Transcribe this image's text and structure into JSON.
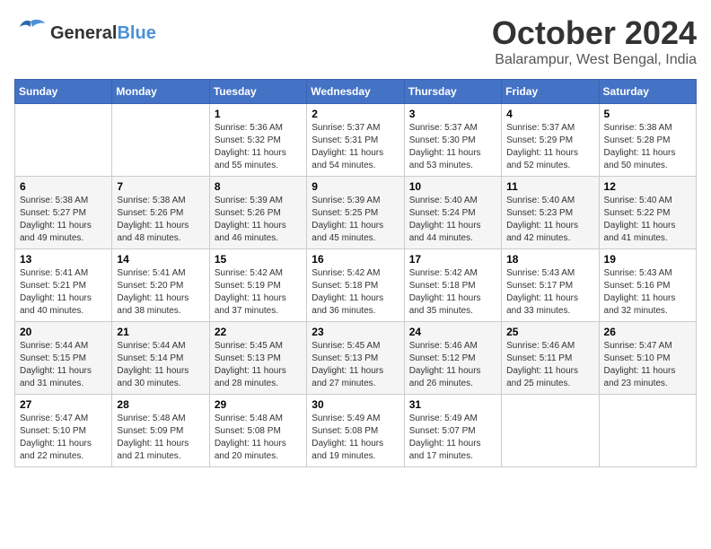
{
  "header": {
    "logo_general": "General",
    "logo_blue": "Blue",
    "month": "October 2024",
    "location": "Balarampur, West Bengal, India"
  },
  "weekdays": [
    "Sunday",
    "Monday",
    "Tuesday",
    "Wednesday",
    "Thursday",
    "Friday",
    "Saturday"
  ],
  "weeks": [
    [
      {
        "day": "",
        "info": ""
      },
      {
        "day": "",
        "info": ""
      },
      {
        "day": "1",
        "sunrise": "Sunrise: 5:36 AM",
        "sunset": "Sunset: 5:32 PM",
        "daylight": "Daylight: 11 hours and 55 minutes."
      },
      {
        "day": "2",
        "sunrise": "Sunrise: 5:37 AM",
        "sunset": "Sunset: 5:31 PM",
        "daylight": "Daylight: 11 hours and 54 minutes."
      },
      {
        "day": "3",
        "sunrise": "Sunrise: 5:37 AM",
        "sunset": "Sunset: 5:30 PM",
        "daylight": "Daylight: 11 hours and 53 minutes."
      },
      {
        "day": "4",
        "sunrise": "Sunrise: 5:37 AM",
        "sunset": "Sunset: 5:29 PM",
        "daylight": "Daylight: 11 hours and 52 minutes."
      },
      {
        "day": "5",
        "sunrise": "Sunrise: 5:38 AM",
        "sunset": "Sunset: 5:28 PM",
        "daylight": "Daylight: 11 hours and 50 minutes."
      }
    ],
    [
      {
        "day": "6",
        "sunrise": "Sunrise: 5:38 AM",
        "sunset": "Sunset: 5:27 PM",
        "daylight": "Daylight: 11 hours and 49 minutes."
      },
      {
        "day": "7",
        "sunrise": "Sunrise: 5:38 AM",
        "sunset": "Sunset: 5:26 PM",
        "daylight": "Daylight: 11 hours and 48 minutes."
      },
      {
        "day": "8",
        "sunrise": "Sunrise: 5:39 AM",
        "sunset": "Sunset: 5:26 PM",
        "daylight": "Daylight: 11 hours and 46 minutes."
      },
      {
        "day": "9",
        "sunrise": "Sunrise: 5:39 AM",
        "sunset": "Sunset: 5:25 PM",
        "daylight": "Daylight: 11 hours and 45 minutes."
      },
      {
        "day": "10",
        "sunrise": "Sunrise: 5:40 AM",
        "sunset": "Sunset: 5:24 PM",
        "daylight": "Daylight: 11 hours and 44 minutes."
      },
      {
        "day": "11",
        "sunrise": "Sunrise: 5:40 AM",
        "sunset": "Sunset: 5:23 PM",
        "daylight": "Daylight: 11 hours and 42 minutes."
      },
      {
        "day": "12",
        "sunrise": "Sunrise: 5:40 AM",
        "sunset": "Sunset: 5:22 PM",
        "daylight": "Daylight: 11 hours and 41 minutes."
      }
    ],
    [
      {
        "day": "13",
        "sunrise": "Sunrise: 5:41 AM",
        "sunset": "Sunset: 5:21 PM",
        "daylight": "Daylight: 11 hours and 40 minutes."
      },
      {
        "day": "14",
        "sunrise": "Sunrise: 5:41 AM",
        "sunset": "Sunset: 5:20 PM",
        "daylight": "Daylight: 11 hours and 38 minutes."
      },
      {
        "day": "15",
        "sunrise": "Sunrise: 5:42 AM",
        "sunset": "Sunset: 5:19 PM",
        "daylight": "Daylight: 11 hours and 37 minutes."
      },
      {
        "day": "16",
        "sunrise": "Sunrise: 5:42 AM",
        "sunset": "Sunset: 5:18 PM",
        "daylight": "Daylight: 11 hours and 36 minutes."
      },
      {
        "day": "17",
        "sunrise": "Sunrise: 5:42 AM",
        "sunset": "Sunset: 5:18 PM",
        "daylight": "Daylight: 11 hours and 35 minutes."
      },
      {
        "day": "18",
        "sunrise": "Sunrise: 5:43 AM",
        "sunset": "Sunset: 5:17 PM",
        "daylight": "Daylight: 11 hours and 33 minutes."
      },
      {
        "day": "19",
        "sunrise": "Sunrise: 5:43 AM",
        "sunset": "Sunset: 5:16 PM",
        "daylight": "Daylight: 11 hours and 32 minutes."
      }
    ],
    [
      {
        "day": "20",
        "sunrise": "Sunrise: 5:44 AM",
        "sunset": "Sunset: 5:15 PM",
        "daylight": "Daylight: 11 hours and 31 minutes."
      },
      {
        "day": "21",
        "sunrise": "Sunrise: 5:44 AM",
        "sunset": "Sunset: 5:14 PM",
        "daylight": "Daylight: 11 hours and 30 minutes."
      },
      {
        "day": "22",
        "sunrise": "Sunrise: 5:45 AM",
        "sunset": "Sunset: 5:13 PM",
        "daylight": "Daylight: 11 hours and 28 minutes."
      },
      {
        "day": "23",
        "sunrise": "Sunrise: 5:45 AM",
        "sunset": "Sunset: 5:13 PM",
        "daylight": "Daylight: 11 hours and 27 minutes."
      },
      {
        "day": "24",
        "sunrise": "Sunrise: 5:46 AM",
        "sunset": "Sunset: 5:12 PM",
        "daylight": "Daylight: 11 hours and 26 minutes."
      },
      {
        "day": "25",
        "sunrise": "Sunrise: 5:46 AM",
        "sunset": "Sunset: 5:11 PM",
        "daylight": "Daylight: 11 hours and 25 minutes."
      },
      {
        "day": "26",
        "sunrise": "Sunrise: 5:47 AM",
        "sunset": "Sunset: 5:10 PM",
        "daylight": "Daylight: 11 hours and 23 minutes."
      }
    ],
    [
      {
        "day": "27",
        "sunrise": "Sunrise: 5:47 AM",
        "sunset": "Sunset: 5:10 PM",
        "daylight": "Daylight: 11 hours and 22 minutes."
      },
      {
        "day": "28",
        "sunrise": "Sunrise: 5:48 AM",
        "sunset": "Sunset: 5:09 PM",
        "daylight": "Daylight: 11 hours and 21 minutes."
      },
      {
        "day": "29",
        "sunrise": "Sunrise: 5:48 AM",
        "sunset": "Sunset: 5:08 PM",
        "daylight": "Daylight: 11 hours and 20 minutes."
      },
      {
        "day": "30",
        "sunrise": "Sunrise: 5:49 AM",
        "sunset": "Sunset: 5:08 PM",
        "daylight": "Daylight: 11 hours and 19 minutes."
      },
      {
        "day": "31",
        "sunrise": "Sunrise: 5:49 AM",
        "sunset": "Sunset: 5:07 PM",
        "daylight": "Daylight: 11 hours and 17 minutes."
      },
      {
        "day": "",
        "info": ""
      },
      {
        "day": "",
        "info": ""
      }
    ]
  ]
}
